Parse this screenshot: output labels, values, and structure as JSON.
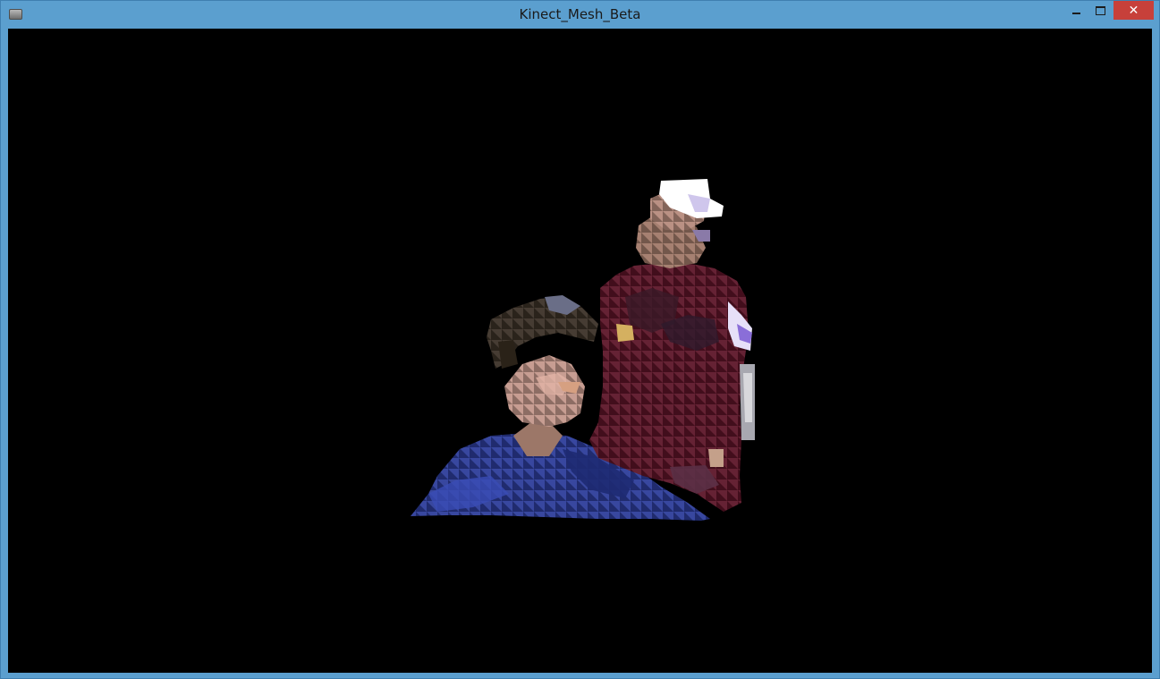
{
  "window": {
    "title": "Kinect_Mesh_Beta",
    "minimize_icon": "minimize-icon",
    "maximize_icon": "maximize-icon",
    "close_icon": "close-icon",
    "close_glyph": "✕"
  },
  "viewport": {
    "background": "#000000"
  },
  "colors": {
    "frame": "#5b9fcf",
    "close": "#c7403a",
    "mesh_blue": "#2f3f9a",
    "mesh_maroon": "#5e1428",
    "mesh_skin": "#b98a7a",
    "mesh_white": "#ffffff"
  }
}
